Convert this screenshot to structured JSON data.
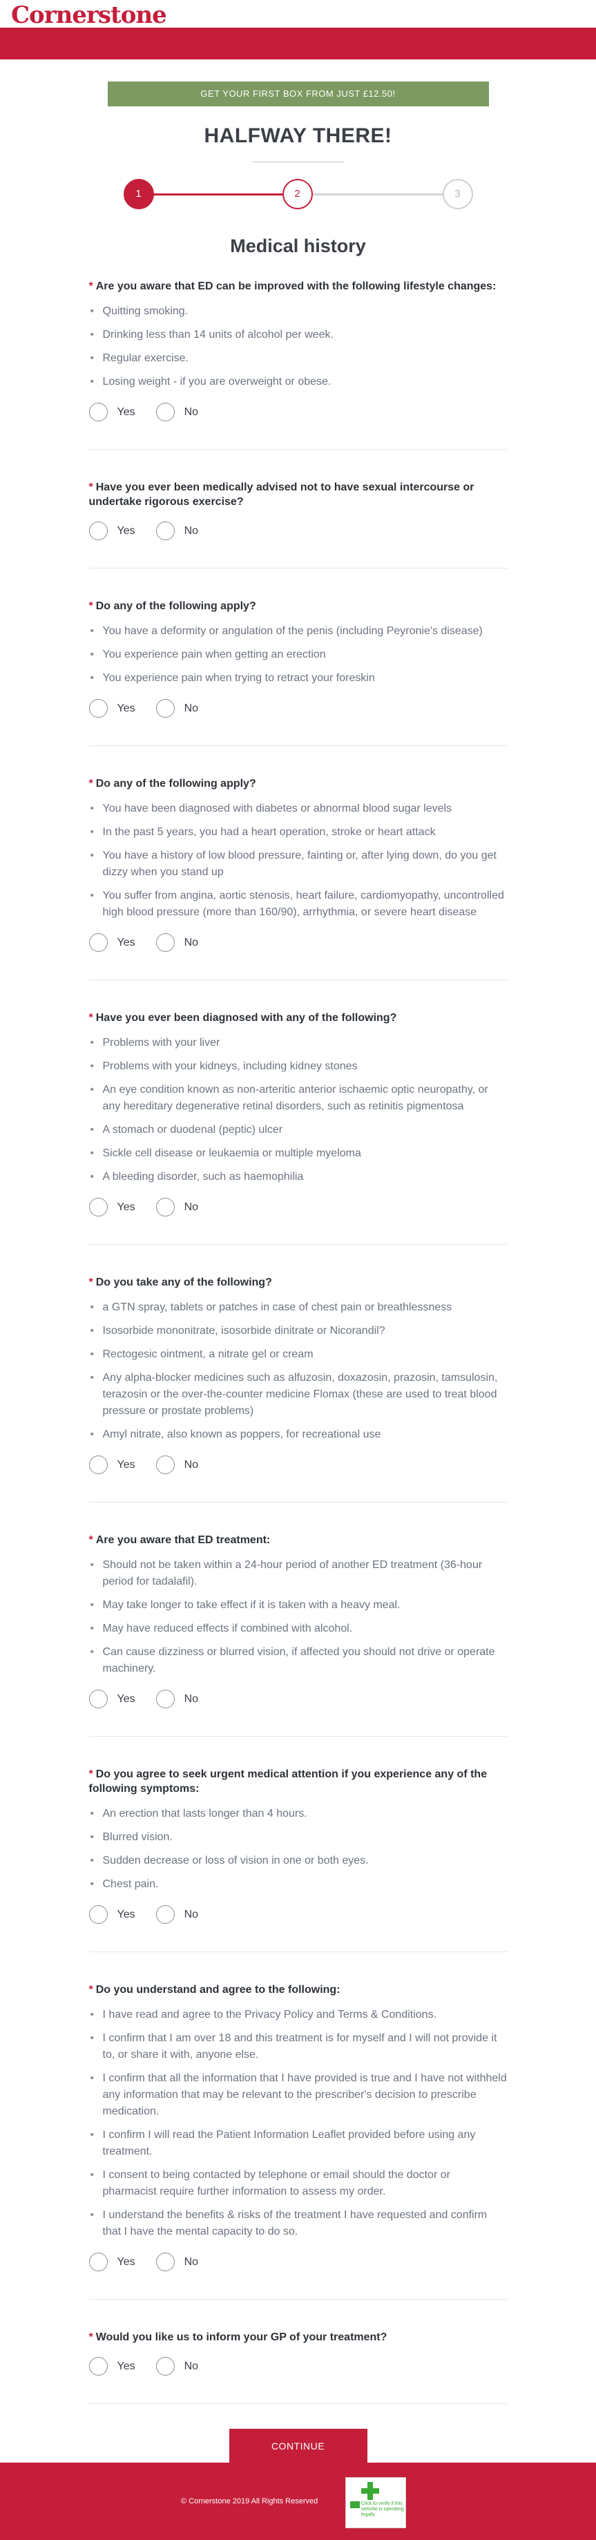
{
  "header": {
    "logo_text": "Cornerstone"
  },
  "promo": {
    "text": "GET YOUR FIRST BOX FROM JUST £12.50!"
  },
  "progress": {
    "heading": "HALFWAY THERE!",
    "steps": [
      "1",
      "2",
      "3"
    ],
    "current_step": 2
  },
  "section": {
    "title": "Medical history"
  },
  "radio_labels": {
    "yes": "Yes",
    "no": "No"
  },
  "questions": [
    {
      "title": "Are you aware that ED can be improved with the following lifestyle changes:",
      "items": [
        "Quitting smoking.",
        "Drinking less than 14 units of alcohol per week.",
        "Regular exercise.",
        "Losing weight - if you are overweight or obese."
      ]
    },
    {
      "title": "Have you ever been medically advised not to have sexual intercourse or undertake rigorous exercise?",
      "items": []
    },
    {
      "title": "Do any of the following apply?",
      "items": [
        "You have a deformity or angulation of the penis (including Peyronie's disease)",
        "You experience pain when getting an erection",
        "You experience pain when trying to retract your foreskin"
      ]
    },
    {
      "title": "Do any of the following apply?",
      "items": [
        "You have been diagnosed with diabetes or abnormal blood sugar levels",
        "In the past 5 years, you had a heart operation, stroke or heart attack",
        "You have a history of low blood pressure, fainting or, after lying down, do you get dizzy when you stand up",
        "You suffer from angina, aortic stenosis, heart failure, cardiomyopathy, uncontrolled high blood pressure (more than 160/90), arrhythmia, or severe heart disease"
      ]
    },
    {
      "title": "Have you ever been diagnosed with any of the following?",
      "items": [
        "Problems with your liver",
        "Problems with your kidneys, including kidney stones",
        "An eye condition known as non-arteritic anterior ischaemic optic neuropathy, or any hereditary degenerative retinal disorders, such as retinitis pigmentosa",
        "A stomach or duodenal (peptic) ulcer",
        "Sickle cell disease or leukaemia or multiple myeloma",
        "A bleeding disorder, such as haemophilia"
      ]
    },
    {
      "title": "Do you take any of the following?",
      "items": [
        "a GTN spray, tablets or patches in case of chest pain or breathlessness",
        "Isosorbide mononitrate, isosorbide dinitrate or Nicorandil?",
        "Rectogesic ointment, a nitrate gel or cream",
        "Any alpha-blocker medicines such as alfuzosin, doxazosin, prazosin, tamsulosin, terazosin or the over-the-counter medicine Flomax (these are used to treat blood pressure or prostate problems)",
        "Amyl nitrate, also known as poppers, for recreational use"
      ]
    },
    {
      "title": "Are you aware that ED treatment:",
      "items": [
        "Should not be taken within a 24-hour period of another ED treatment (36-hour period for tadalafil).",
        "May take longer to take effect if it is taken with a heavy meal.",
        "May have reduced effects if combined with alcohol.",
        "Can cause dizziness or blurred vision, if affected you should not drive or operate machinery."
      ]
    },
    {
      "title": "Do you agree to seek urgent medical attention if you experience any of the following symptoms:",
      "items": [
        "An erection that lasts longer than 4 hours.",
        "Blurred vision.",
        "Sudden decrease or loss of vision in one or both eyes.",
        "Chest pain."
      ]
    },
    {
      "title": "Do you understand and agree to the following:",
      "items": [
        "I have read and agree to the Privacy Policy and Terms & Conditions.",
        "I confirm that I am over 18 and this treatment is for myself and I will not provide it to, or share it with, anyone else.",
        "I confirm that all the information that I have provided is true and I have not withheld any information that may be relevant to the prescriber's decision to prescribe medication.",
        "I confirm I will read the Patient Information Leaflet provided before using any treatment.",
        "I consent to being contacted by telephone or email should the doctor or pharmacist require further information to assess my order.",
        "I understand the benefits & risks of the treatment I have requested and confirm that I have the mental capacity to do so."
      ]
    },
    {
      "title": "Would you like us to inform your GP of your treatment?",
      "items": []
    }
  ],
  "continue_label": "CONTINUE",
  "footer": {
    "copyright": "© Cornerstone 2019 All Rights Reserved",
    "badge_text": "Click to verify if this website is operating legally"
  }
}
